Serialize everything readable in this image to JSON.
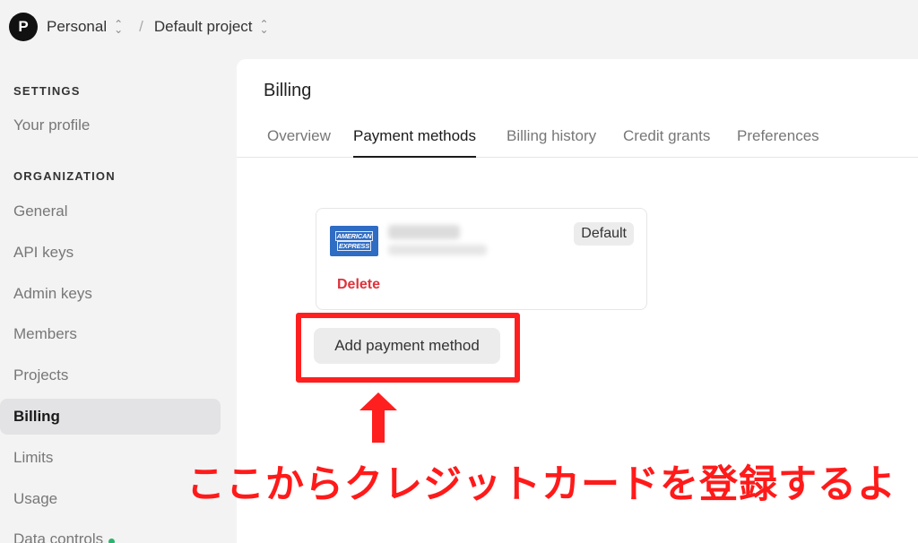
{
  "topbar": {
    "avatar_letter": "P",
    "org_name": "Personal",
    "separator": "/",
    "project_name": "Default project"
  },
  "sidebar": {
    "settings_heading": "SETTINGS",
    "your_profile": "Your profile",
    "organization_heading": "ORGANIZATION",
    "items": [
      {
        "label": "General"
      },
      {
        "label": "API keys"
      },
      {
        "label": "Admin keys"
      },
      {
        "label": "Members"
      },
      {
        "label": "Projects"
      },
      {
        "label": "Billing",
        "active": true
      },
      {
        "label": "Limits"
      },
      {
        "label": "Usage"
      },
      {
        "label": "Data controls"
      }
    ]
  },
  "main": {
    "title": "Billing",
    "tabs": [
      {
        "label": "Overview"
      },
      {
        "label": "Payment methods",
        "active": true
      },
      {
        "label": "Billing history"
      },
      {
        "label": "Credit grants"
      },
      {
        "label": "Preferences"
      }
    ],
    "card": {
      "brand_line1": "AMERICAN",
      "brand_line2": "EXPRESS",
      "badge": "Default",
      "delete_label": "Delete"
    },
    "add_button": "Add payment method"
  },
  "annotation": {
    "caption": "ここからクレジットカードを登録するよ",
    "color": "#ff1f1f"
  }
}
